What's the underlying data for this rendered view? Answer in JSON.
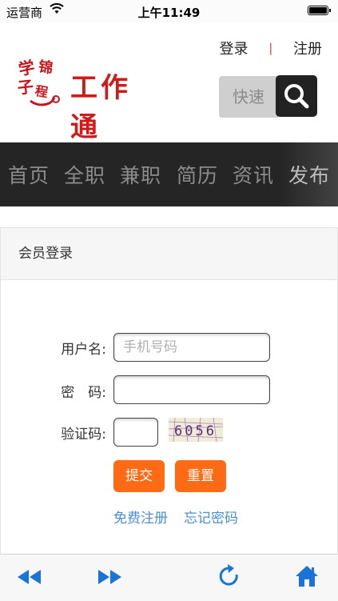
{
  "status_bar": {
    "carrier": "运营商",
    "time": "上午11:49"
  },
  "header": {
    "login_link": "登录",
    "separator": "|",
    "register_link": "注册",
    "logo_seal_text": "学子锦程",
    "logo_text": "工作通",
    "search_placeholder": "快速",
    "search_icon": "search-icon"
  },
  "nav": {
    "items": [
      "首页",
      "全职",
      "兼职",
      "简历",
      "资讯",
      "发布"
    ]
  },
  "login_panel": {
    "title": "会员登录",
    "username_label": "用户名:",
    "username_placeholder": "手机号码",
    "password_label": "密　码:",
    "captcha_label": "验证码:",
    "captcha_text": "6056",
    "submit_label": "提交",
    "reset_label": "重置",
    "free_register_link": "免费注册",
    "forgot_password_link": "忘记密码"
  },
  "toolbar": {
    "icons": [
      "back-icon",
      "forward-icon",
      "reload-icon",
      "home-icon"
    ]
  },
  "colors": {
    "accent_orange": "#ff6a14",
    "nav_bg": "#252525",
    "link_blue": "#4a8fd0",
    "toolbar_blue": "#1a73d9",
    "logo_red": "#d11a1a"
  }
}
